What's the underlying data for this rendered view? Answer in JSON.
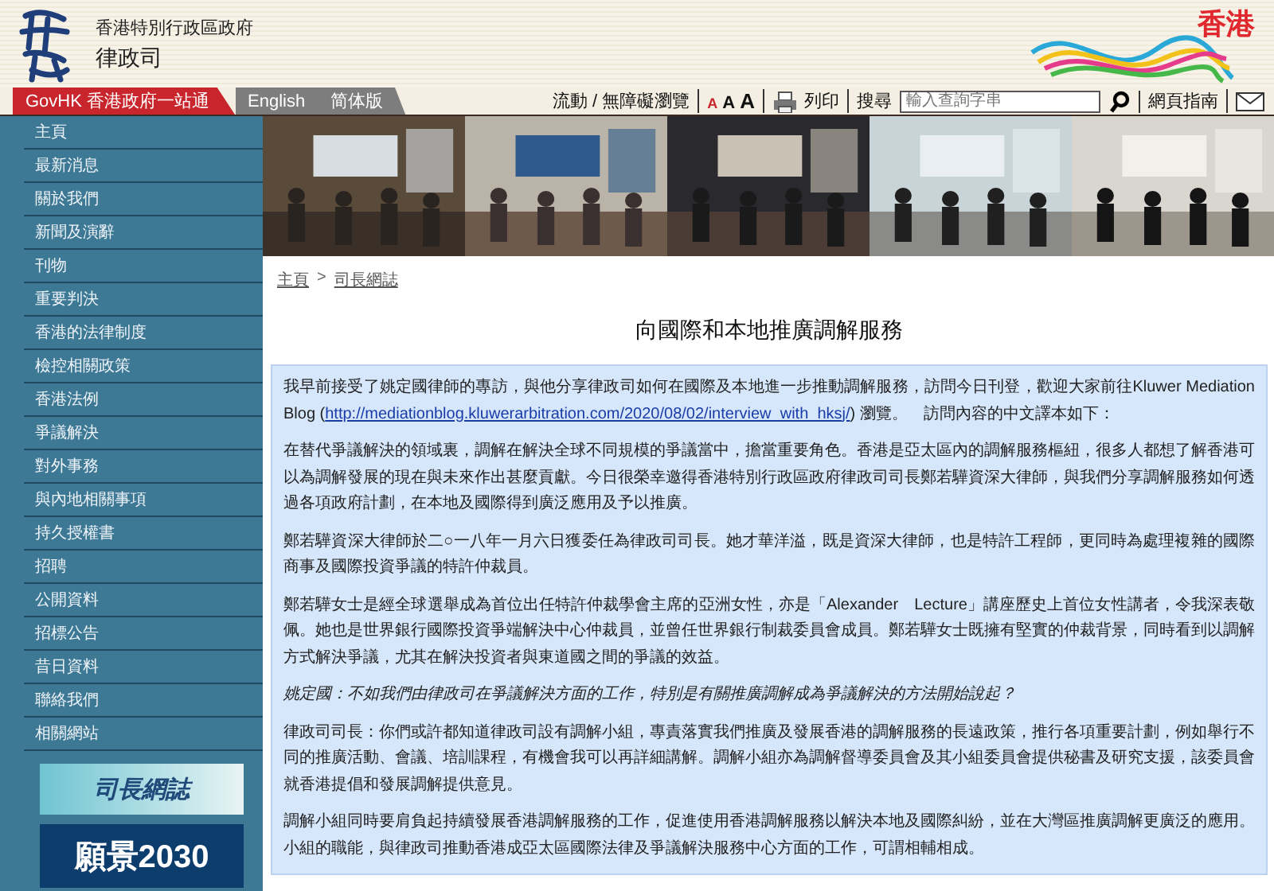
{
  "header": {
    "agency_line": "香港特別行政區政府",
    "agency_name": "律政司",
    "brand": "香港"
  },
  "nav": {
    "tabs": [
      {
        "label": "GovHK 香港政府一站通",
        "kind": "red"
      },
      {
        "label": "English",
        "kind": "grey"
      },
      {
        "label": "简体版",
        "kind": "grey"
      }
    ],
    "accessibility": "流動 / 無障礙瀏覽",
    "font_sizes": [
      {
        "label": "A",
        "selected": true
      },
      {
        "label": "A",
        "selected": false
      },
      {
        "label": "A",
        "selected": false
      }
    ],
    "print": "列印",
    "search_label": "搜尋",
    "search": {
      "placeholder": "輸入查詢字串"
    },
    "guide": "網頁指南"
  },
  "sidebar": {
    "items": [
      "主頁",
      "最新消息",
      "關於我們",
      "新聞及演辭",
      "刊物",
      "重要判決",
      "香港的法律制度",
      "檢控相關政策",
      "香港法例",
      "爭議解決",
      "對外事務",
      "與內地相關事項",
      "持久授權書",
      "招聘",
      "公開資料",
      "招標公告",
      "昔日資料",
      "聯絡我們",
      "相關網站"
    ],
    "banners": [
      {
        "label": "司長網誌",
        "kind": "light"
      },
      {
        "label": "願景2030",
        "kind": "dark"
      }
    ]
  },
  "breadcrumb": {
    "items": [
      "主頁",
      "司長網誌"
    ],
    "separator": ">"
  },
  "title": "向國際和本地推廣調解服務",
  "paragraphs": [
    {
      "kind": "link",
      "before": "我早前接受了姚定國律師的專訪，與他分享律政司如何在國際及本地進一步推動調解服務，訪問今日刊登，歡迎大家前往Kluwer Mediation Blog (",
      "link": "http://mediationblog.kluwerarbitration.com/2020/08/02/interview_with_hksj/",
      "after": ") 瀏覽。　訪問內容的中文譯本如下："
    },
    {
      "kind": "text",
      "text": "在替代爭議解決的領域裏，調解在解決全球不同規模的爭議當中，擔當重要角色。香港是亞太區內的調解服務樞紐，很多人都想了解香港可以為調解發展的現在與未來作出甚麼貢獻。今日很榮幸邀得香港特別行政區政府律政司司長鄭若驊資深大律師，與我們分享調解服務如何透過各項政府計劃，在本地及國際得到廣泛應用及予以推廣。"
    },
    {
      "kind": "text",
      "text": "鄭若驊資深大律師於二○一八年一月六日獲委任為律政司司長。她才華洋溢，既是資深大律師，也是特許工程師，更同時為處理複雜的國際商事及國際投資爭議的特許仲裁員。"
    },
    {
      "kind": "text",
      "text": "鄭若驊女士是經全球選舉成為首位出任特許仲裁學會主席的亞洲女性，亦是「Alexander　Lecture」講座歷史上首位女性講者，令我深表敬佩。她也是世界銀行國際投資爭端解決中心仲裁員，並曾任世界銀行制裁委員會成員。鄭若驊女士既擁有堅實的仲裁背景，同時看到以調解方式解決爭議，尤其在解決投資者與東道國之間的爭議的效益。"
    },
    {
      "kind": "question",
      "text": "姚定國：不如我們由律政司在爭議解決方面的工作，特別是有關推廣調解成為爭議解決的方法開始說起？"
    },
    {
      "kind": "text",
      "text": "律政司司長：你們或許都知道律政司設有調解小組，專責落實我們推廣及發展香港的調解服務的長遠政策，推行各項重要計劃，例如舉行不同的推廣活動、會議、培訓課程，有機會我可以再詳細講解。調解小組亦為調解督導委員會及其小組委員會提供秘書及研究支援，該委員會就香港提倡和發展調解提供意見。"
    },
    {
      "kind": "text",
      "text": "調解小組同時要肩負起持續發展香港調解服務的工作，促進使用香港調解服務以解決本地及國際糾紛，並在大灣區推廣調解更廣泛的應用。小組的職能，與律政司推動香港成亞太區國際法律及爭議解決服務中心方面的工作，可謂相輔相成。"
    }
  ]
}
